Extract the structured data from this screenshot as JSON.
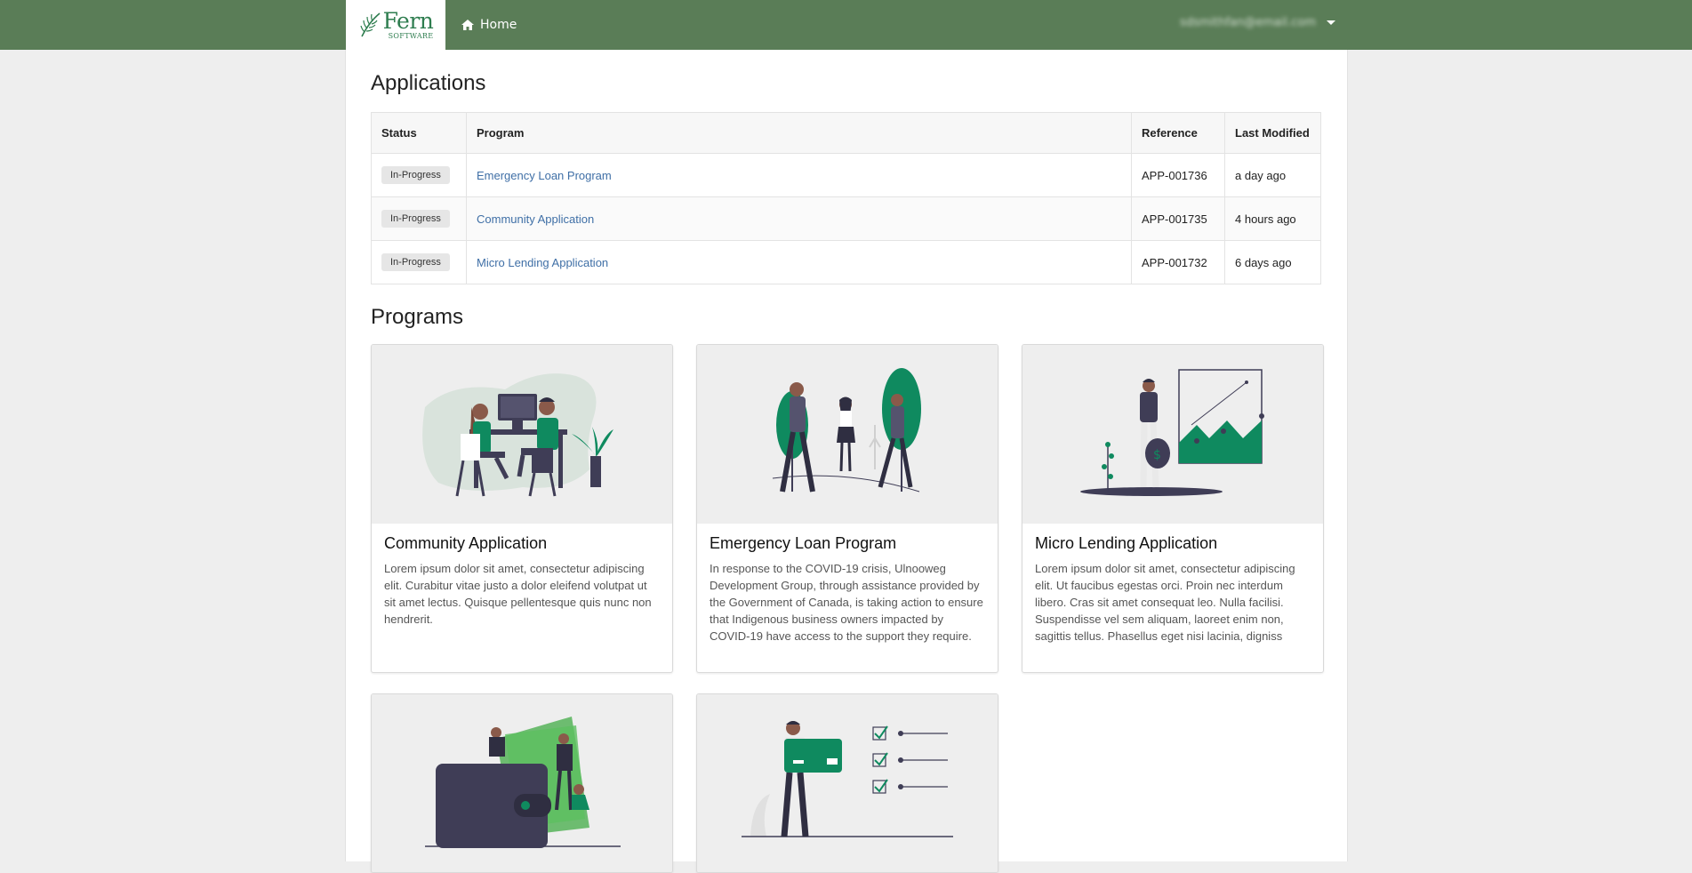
{
  "navbar": {
    "brand_name": "Fern",
    "brand_sub": "SOFTWARE",
    "home_label": "Home",
    "user_email": "sdsmithfan@email.com",
    "bg_color": "#5a7d57"
  },
  "applications": {
    "title": "Applications",
    "columns": [
      "Status",
      "Program",
      "Reference",
      "Last Modified"
    ],
    "rows": [
      {
        "status": "In-Progress",
        "program": "Emergency Loan Program",
        "reference": "APP-001736",
        "modified": "a day ago"
      },
      {
        "status": "In-Progress",
        "program": "Community Application",
        "reference": "APP-001735",
        "modified": "4 hours ago"
      },
      {
        "status": "In-Progress",
        "program": "Micro Lending Application",
        "reference": "APP-001732",
        "modified": "6 days ago"
      }
    ]
  },
  "programs": {
    "title": "Programs",
    "cards": [
      {
        "title": "Community Application",
        "description": "Lorem ipsum dolor sit amet, consectetur adipiscing elit. Curabitur vitae justo a dolor eleifend volutpat ut sit amet lectus. Quisque pellentesque quis nunc non hendrerit."
      },
      {
        "title": "Emergency Loan Program",
        "description": "In response to the COVID-19 crisis, Ulnooweg Development Group, through assistance provided by the Government of Canada, is taking action to ensure that Indigenous business owners impacted by COVID-19 have access to the support they require."
      },
      {
        "title": "Micro Lending Application",
        "description": "Lorem ipsum dolor sit amet, consectetur adipiscing elit. Ut faucibus egestas orci. Proin nec interdum libero. Cras sit amet consequat leo. Nulla facilisi. Suspendisse vel sem aliquam, laoreet enim non, sagittis tellus. Phasellus eget nisi lacinia, digniss"
      },
      {
        "title": "",
        "description": ""
      },
      {
        "title": "",
        "description": ""
      }
    ]
  },
  "colors": {
    "accent_green": "#0f8a5f",
    "link": "#3f6fa6",
    "dark_figure": "#3f3d56"
  }
}
